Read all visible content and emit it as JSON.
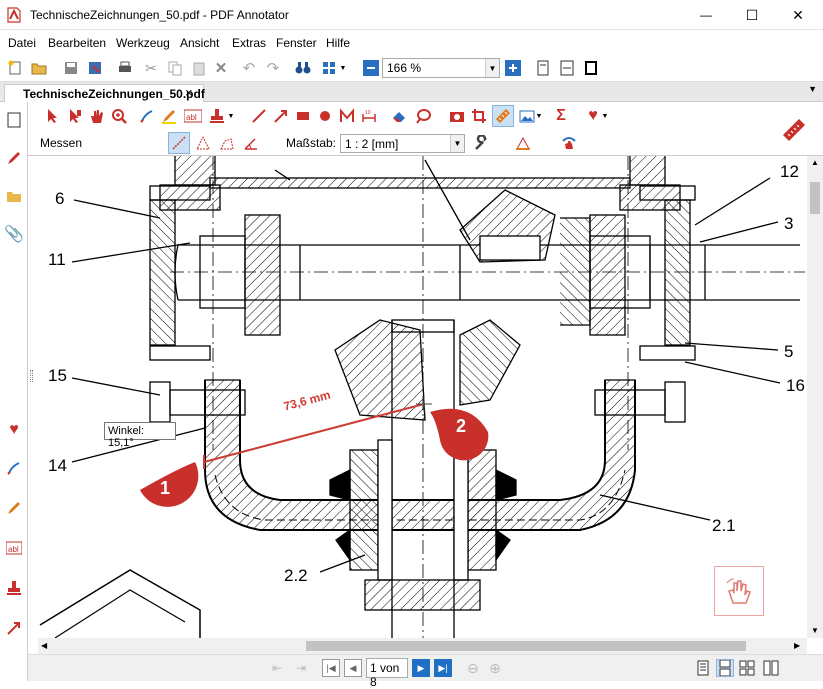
{
  "window": {
    "title": "TechnischeZeichnungen_50.pdf - PDF Annotator",
    "minimize": "—",
    "maximize": "☐",
    "close": "✕"
  },
  "menu": [
    "Datei",
    "Bearbeiten",
    "Werkzeug",
    "Ansicht",
    "Extras",
    "Fenster",
    "Hilfe"
  ],
  "toolbar": {
    "zoom": "166 %"
  },
  "tab": {
    "label": "TechnischeZeichnungen_50.pdf",
    "close": "×"
  },
  "measure_bar": {
    "mode_label": "Messen",
    "scale_label": "Maßstab:",
    "scale_value": "1 : 2 [mm]"
  },
  "drawing": {
    "callouts": [
      "6",
      "11",
      "15",
      "14",
      "12",
      "3",
      "5",
      "16",
      "2.1",
      "2.2"
    ],
    "measurement": "73,6 mm",
    "angle_tooltip": "Winkel: 15,1°",
    "point_1": "1",
    "point_2": "2"
  },
  "status": {
    "page_input": "1 von 8"
  },
  "colors": {
    "accent_red": "#c9302c",
    "measure_red": "#cc3d34",
    "blue_button": "#1f6fc4"
  }
}
